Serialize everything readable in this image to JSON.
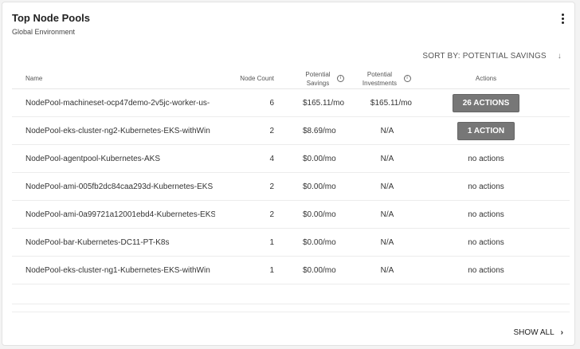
{
  "header": {
    "title": "Top Node Pools",
    "subtitle": "Global Environment"
  },
  "sort": {
    "label": "SORT BY: POTENTIAL SAVINGS",
    "arrow": "↓"
  },
  "columns": {
    "name": "Name",
    "node_count": "Node Count",
    "savings": "Potential Savings",
    "investments": "Potential Investments",
    "actions": "Actions",
    "info": "i"
  },
  "rows": [
    {
      "name": "NodePool-machineset-ocp47demo-2v5jc-worker-us-",
      "count": "6",
      "savings": "$165.11/mo",
      "investments": "$165.11/mo",
      "actions": "26 ACTIONS",
      "button": true
    },
    {
      "name": "NodePool-eks-cluster-ng2-Kubernetes-EKS-withWin",
      "count": "2",
      "savings": "$8.69/mo",
      "investments": "N/A",
      "actions": "1 ACTION",
      "button": true
    },
    {
      "name": "NodePool-agentpool-Kubernetes-AKS",
      "count": "4",
      "savings": "$0.00/mo",
      "investments": "N/A",
      "actions": "no actions",
      "button": false
    },
    {
      "name": "NodePool-ami-005fb2dc84caa293d-Kubernetes-EKS",
      "count": "2",
      "savings": "$0.00/mo",
      "investments": "N/A",
      "actions": "no actions",
      "button": false
    },
    {
      "name": "NodePool-ami-0a99721a12001ebd4-Kubernetes-EKS",
      "count": "2",
      "savings": "$0.00/mo",
      "investments": "N/A",
      "actions": "no actions",
      "button": false
    },
    {
      "name": "NodePool-bar-Kubernetes-DC11-PT-K8s",
      "count": "1",
      "savings": "$0.00/mo",
      "investments": "N/A",
      "actions": "no actions",
      "button": false
    },
    {
      "name": "NodePool-eks-cluster-ng1-Kubernetes-EKS-withWin",
      "count": "1",
      "savings": "$0.00/mo",
      "investments": "N/A",
      "actions": "no actions",
      "button": false
    }
  ],
  "footer": {
    "show_all": "SHOW ALL",
    "chevron": "›"
  }
}
